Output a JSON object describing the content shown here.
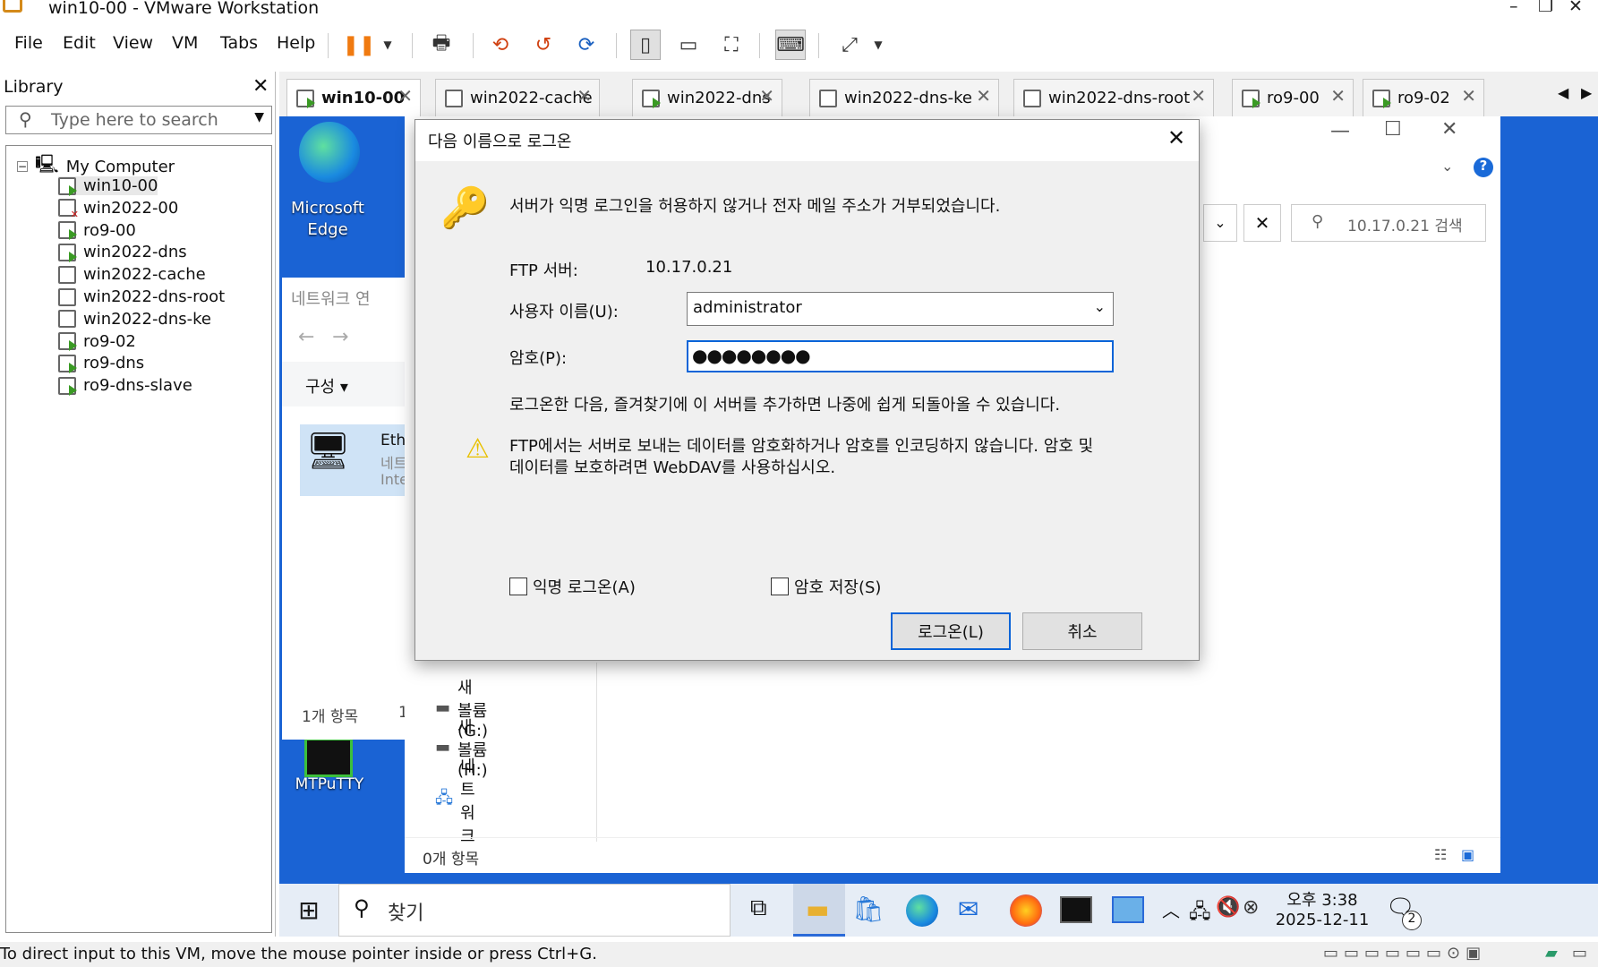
{
  "app": {
    "title": "win10-00 - VMware Workstation",
    "menus": [
      "File",
      "Edit",
      "View",
      "VM",
      "Tabs",
      "Help"
    ]
  },
  "library": {
    "title": "Library",
    "search_placeholder": "Type here to search",
    "root": "My Computer",
    "vms": [
      {
        "name": "win10-00",
        "state": "on"
      },
      {
        "name": "win2022-00",
        "state": "err"
      },
      {
        "name": "ro9-00",
        "state": "on"
      },
      {
        "name": "win2022-dns",
        "state": "on"
      },
      {
        "name": "win2022-cache",
        "state": "off"
      },
      {
        "name": "win2022-dns-root",
        "state": "off"
      },
      {
        "name": "win2022-dns-ke",
        "state": "off"
      },
      {
        "name": "ro9-02",
        "state": "on"
      },
      {
        "name": "ro9-dns",
        "state": "on"
      },
      {
        "name": "ro9-dns-slave",
        "state": "on"
      }
    ]
  },
  "tabs": [
    "win10-00",
    "win2022-cache",
    "win2022-dns",
    "win2022-dns-ke",
    "win2022-dns-root",
    "ro9-00",
    "ro9-02"
  ],
  "desktop": {
    "edge_label_1": "Microsoft",
    "edge_label_2": "Edge",
    "mtputty_label": "MTPuTTY"
  },
  "netwin": {
    "title": "네트워크 연",
    "organize": "구성 ▾",
    "item_name": "Eth",
    "item_sub1": "네트",
    "item_sub2": "Inte",
    "count": "1개 항목",
    "count2": "1"
  },
  "explorer": {
    "search_placeholder": "10.17.0.21 검색",
    "nav": [
      {
        "label": "새 볼륨 (G:)",
        "icon": "drive-icon"
      },
      {
        "label": "새 볼륨 (H:)",
        "icon": "drive-icon"
      },
      {
        "label": "네트워크",
        "icon": "network-icon"
      }
    ],
    "count": "0개 항목"
  },
  "dialog": {
    "title": "다음 이름으로 로그온",
    "message": "서버가 익명 로그인을 허용하지 않거나 전자 메일 주소가 거부되었습니다.",
    "ftp_label": "FTP 서버:",
    "ftp_value": "10.17.0.21",
    "user_label": "사용자 이름(U):",
    "user_value": "administrator",
    "password_label": "암호(P):",
    "password_value": "●●●●●●●●",
    "tip": "로그온한 다음, 즐겨찾기에 이 서버를 추가하면 나중에 쉽게 되돌아올 수 있습니다.",
    "warning_1": "FTP에서는 서버로 보내는 데이터를 암호화하거나 암호를 인코딩하지 않습니다. 암호 및",
    "warning_2": "데이터를 보호하려면 WebDAV를 사용하십시오.",
    "anon_label": "익명 로그온(A)",
    "save_label": "암호 저장(S)",
    "login_button": "로그온(L)",
    "cancel_button": "취소"
  },
  "taskbar": {
    "search": "찾기",
    "time": "오후 3:38",
    "date": "2025-12-11",
    "notif_count": "2"
  },
  "status": "To direct input to this VM, move the mouse pointer inside or press Ctrl+G."
}
